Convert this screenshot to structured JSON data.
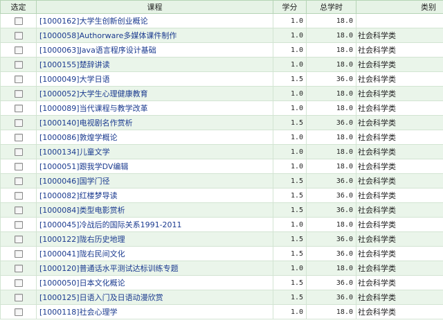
{
  "headers": {
    "select": "选定",
    "course": "课程",
    "credit": "学分",
    "hours": "总学时",
    "category": "类别"
  },
  "rows": [
    {
      "course": "[1000162]大学生创新创业概论",
      "credit": "1.0",
      "hours": "18.0",
      "category": ""
    },
    {
      "course": "[1000058]Authorware多媒体课件制作",
      "credit": "1.0",
      "hours": "18.0",
      "category": "社会科学类"
    },
    {
      "course": "[1000063]Java语言程序设计基础",
      "credit": "1.0",
      "hours": "18.0",
      "category": "社会科学类"
    },
    {
      "course": "[1000155]楚辞讲读",
      "credit": "1.0",
      "hours": "18.0",
      "category": "社会科学类"
    },
    {
      "course": "[1000049]大学日语",
      "credit": "1.5",
      "hours": "36.0",
      "category": "社会科学类"
    },
    {
      "course": "[1000052]大学生心理健康教育",
      "credit": "1.0",
      "hours": "18.0",
      "category": "社会科学类"
    },
    {
      "course": "[1000089]当代课程与教学改革",
      "credit": "1.0",
      "hours": "18.0",
      "category": "社会科学类"
    },
    {
      "course": "[1000140]电视剧名作赏析",
      "credit": "1.5",
      "hours": "36.0",
      "category": "社会科学类"
    },
    {
      "course": "[1000086]敦煌学概论",
      "credit": "1.0",
      "hours": "18.0",
      "category": "社会科学类"
    },
    {
      "course": "[1000134]儿童文学",
      "credit": "1.0",
      "hours": "18.0",
      "category": "社会科学类"
    },
    {
      "course": "[1000051]跟我学DV编辑",
      "credit": "1.0",
      "hours": "18.0",
      "category": "社会科学类"
    },
    {
      "course": "[1000046]国学门径",
      "credit": "1.5",
      "hours": "36.0",
      "category": "社会科学类"
    },
    {
      "course": "[1000082]红楼梦导读",
      "credit": "1.5",
      "hours": "36.0",
      "category": "社会科学类"
    },
    {
      "course": "[1000084]类型电影赏析",
      "credit": "1.5",
      "hours": "36.0",
      "category": "社会科学类"
    },
    {
      "course": "[1000045]冷战后的国际关系1991-2011",
      "credit": "1.0",
      "hours": "18.0",
      "category": "社会科学类"
    },
    {
      "course": "[1000122]陇右历史地理",
      "credit": "1.5",
      "hours": "36.0",
      "category": "社会科学类"
    },
    {
      "course": "[1000041]陇右民间文化",
      "credit": "1.5",
      "hours": "36.0",
      "category": "社会科学类"
    },
    {
      "course": "[1000120]普通话水平测试达标训练专题",
      "credit": "1.0",
      "hours": "18.0",
      "category": "社会科学类"
    },
    {
      "course": "[1000050]日本文化概论",
      "credit": "1.5",
      "hours": "36.0",
      "category": "社会科学类"
    },
    {
      "course": "[1000125]日语入门及日语动漫欣赏",
      "credit": "1.5",
      "hours": "36.0",
      "category": "社会科学类"
    },
    {
      "course": "[1000118]社会心理学",
      "credit": "1.0",
      "hours": "18.0",
      "category": "社会科学类"
    }
  ]
}
